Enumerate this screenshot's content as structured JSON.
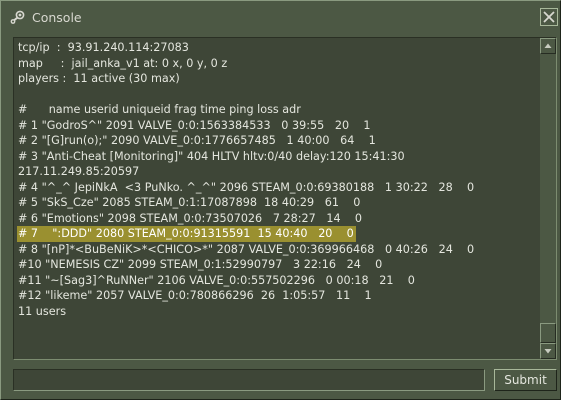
{
  "window": {
    "title": "Console",
    "icon": "steam-icon",
    "close_icon": "close-icon"
  },
  "colors": {
    "background": "#4c5844",
    "console_bg": "#3e4637",
    "text": "#e4e6de",
    "selection": "#9a9030"
  },
  "console": {
    "lines": [
      "tcp/ip  :  93.91.240.114:27083",
      "map     :  jail_anka_v1 at: 0 x, 0 y, 0 z",
      "players :  11 active (30 max)",
      "",
      "#      name userid uniqueid frag time ping loss adr",
      "# 1 \"GodroS^\" 2091 VALVE_0:0:1563384533   0 39:55   20    1",
      "# 2 \"[G]run(o);\" 2090 VALVE_0:0:1776657485   1 40:00   64    1",
      "# 3 \"Anti-Cheat [Monitoring]\" 404 HLTV hltv:0/40 delay:120 15:41:30",
      "217.11.249.85:20597",
      "# 4 \"^_^ JepiNkA  <3 PuNko. ^_^\" 2096 STEAM_0:0:69380188   1 30:22   28    0",
      "# 5 \"SkS_Cze\" 2085 STEAM_0:1:17087898  18 40:29   61    0",
      "# 6 \"Emotions\" 2098 STEAM_0:0:73507026   7 28:27   14    0",
      "# 7    \":DDD\" 2080 STEAM_0:0:91315591  15 40:40   20    0",
      "# 8 \"[nP]*<BuBeNiK>*<CHICO>*\" 2087 VALVE_0:0:369966468   0 40:26   24    0",
      "#10 \"NEMESIS CZ\" 2099 STEAM_0:1:52990797   3 22:16   24    0",
      "#11 \"~[Sag3]^RuNNer\" 2106 VALVE_0:0:557502296   0 00:18   21    0",
      "#12 \"likeme\" 2057 VALVE_0:0:780866296  26  1:05:57   11    1",
      "11 users"
    ],
    "selected_line_index": 12
  },
  "scrollbar": {
    "up_icon": "arrow-up-icon",
    "down_icon": "arrow-down-icon",
    "position": 1.0
  },
  "command": {
    "value": "",
    "placeholder": ""
  },
  "submit": {
    "label": "Submit"
  }
}
